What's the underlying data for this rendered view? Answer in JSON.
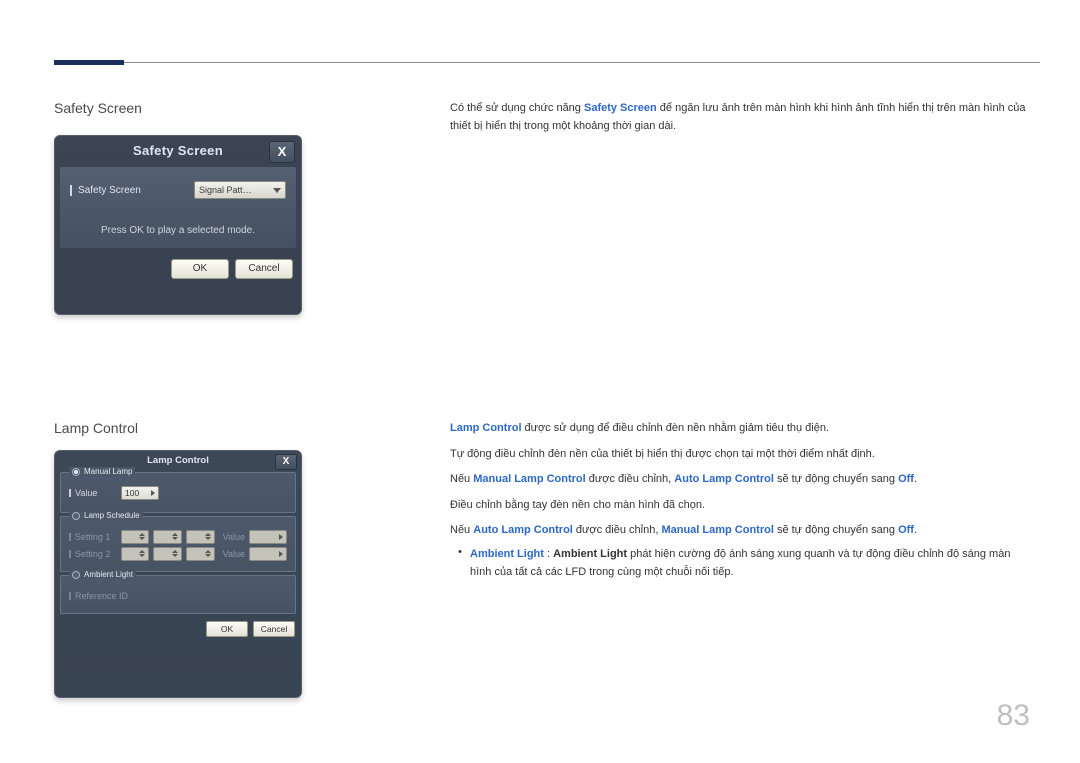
{
  "page_number": "83",
  "sections": {
    "safety": {
      "title": "Safety Screen",
      "desc_pre": "Có thể sử dụng chức năng ",
      "desc_key": "Safety Screen",
      "desc_post": " để ngăn lưu ảnh trên màn hình khi hình ảnh tĩnh hiển thị trên màn hình của thiết bị hiển thị trong một khoảng thời gian dài.",
      "dialog": {
        "title": "Safety Screen",
        "close": "X",
        "row_label": "Safety Screen",
        "combo_value": "Signal Patt…",
        "hint": "Press OK to play a selected mode.",
        "ok": "OK",
        "cancel": "Cancel"
      }
    },
    "lamp": {
      "title": "Lamp Control",
      "para1": {
        "k1": "Lamp Control",
        "t1": " được sử dụng để điều chỉnh đèn nền nhằm giảm tiêu thụ điện."
      },
      "para2": "Tự động điều chỉnh đèn nền của thiết bị hiển thị được chọn tại một thời điểm nhất định.",
      "para3": {
        "pre": "Nếu ",
        "k1": "Manual Lamp Control",
        "mid1": " được điều chỉnh, ",
        "k2": "Auto Lamp Control",
        "mid2": " sẽ tự động chuyển sang ",
        "k3": "Off",
        "post": "."
      },
      "para4": "Điều chỉnh bằng tay đèn nền cho màn hình đã chọn.",
      "para5": {
        "pre": "Nếu ",
        "k1": "Auto Lamp Control",
        "mid1": " được điều chỉnh, ",
        "k2": "Manual Lamp Control",
        "mid2": " sẽ tự động chuyển sang ",
        "k3": "Off",
        "post": "."
      },
      "bullet": {
        "k1": "Ambient Light",
        "sep": " : ",
        "k2": "Ambient Light",
        "text": " phát hiện cường độ ánh sáng xung quanh và tự động điều chỉnh độ sáng màn hình của tất cả các LFD trong cùng một chuỗi nối tiếp."
      },
      "dialog": {
        "title": "Lamp Control",
        "close": "X",
        "group1": {
          "legend": "Manual Lamp",
          "value_label": "Value",
          "value": "100"
        },
        "group2": {
          "legend": "Lamp Schedule",
          "row1_label": "Setting 1",
          "row2_label": "Setting 2",
          "val_label": "Value"
        },
        "group3": {
          "legend": "Ambient Light",
          "row_label": "Reference ID"
        },
        "ok": "OK",
        "cancel": "Cancel"
      }
    }
  }
}
